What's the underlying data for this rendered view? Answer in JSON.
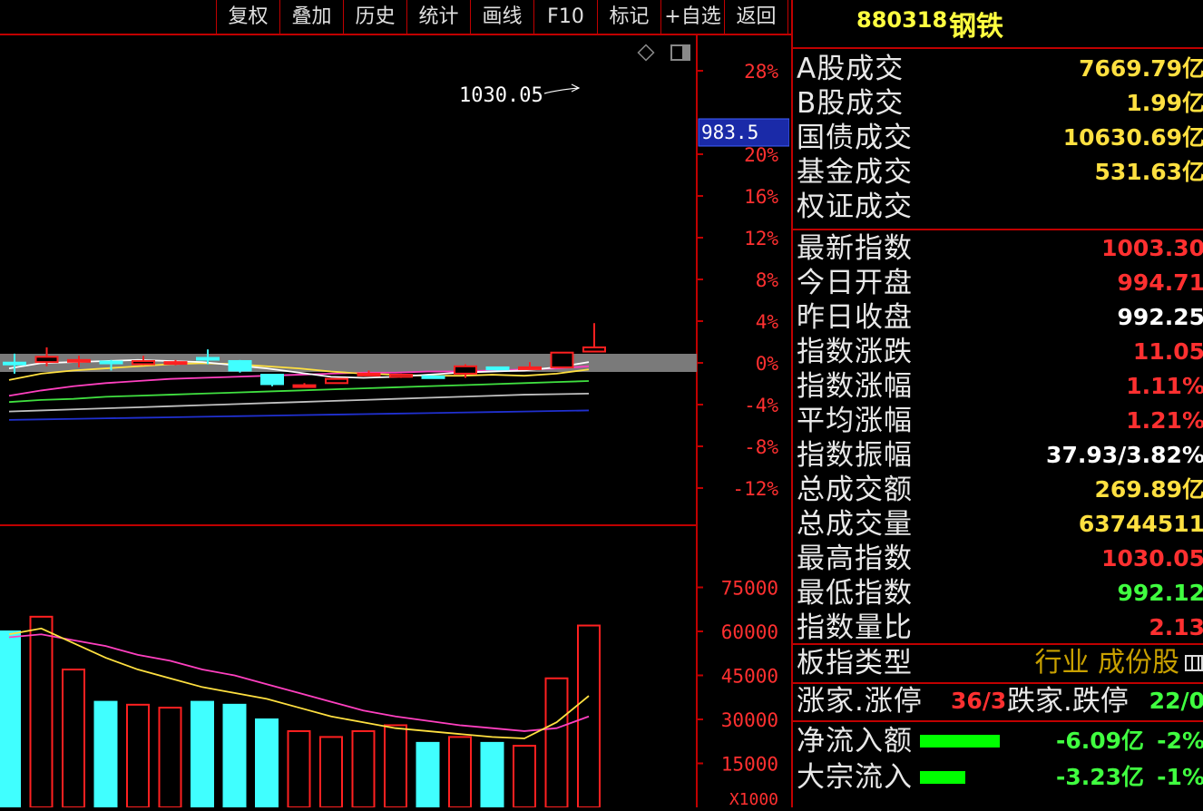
{
  "toolbar": {
    "buttons": [
      "复权",
      "叠加",
      "历史",
      "统计",
      "画线",
      "F10",
      "标记",
      "+自选",
      "返回"
    ]
  },
  "chart": {
    "annotation_high": "1030.05",
    "current_price_tag": "983.5",
    "price_axis_labels": [
      "28%",
      "20%",
      "16%",
      "12%",
      "8%",
      "4%",
      "0%",
      "-4%",
      "-8%",
      "-12%"
    ],
    "volume_axis_labels": [
      "75000",
      "60000",
      "45000",
      "30000",
      "15000",
      "X1000"
    ],
    "colors": {
      "up": "#ff2020",
      "down": "#40ffff",
      "ma5": "#ffffff",
      "ma10": "#ffe040",
      "ma20": "#ff40c0",
      "ma60": "#40e040",
      "ma120": "#c0c0c0",
      "ma250": "#2030d0",
      "axis": "#c00000",
      "tag_bg": "#1a2aa8"
    },
    "candles": [
      {
        "o": 992.5,
        "c": 992.5,
        "h": 1001,
        "l": 982,
        "up": false
      },
      {
        "o": 998,
        "c": 993,
        "h": 1007,
        "l": 989,
        "up": true
      },
      {
        "o": 995,
        "c": 995,
        "h": 999,
        "l": 988,
        "up": true
      },
      {
        "o": 992,
        "c": 993.5,
        "h": 995,
        "l": 985,
        "up": false
      },
      {
        "o": 991,
        "c": 994,
        "h": 999,
        "l": 990,
        "up": true
      },
      {
        "o": 993,
        "c": 993,
        "h": 995,
        "l": 990,
        "up": true
      },
      {
        "o": 997,
        "c": 997,
        "h": 1005,
        "l": 991,
        "up": false
      },
      {
        "o": 994,
        "c": 985,
        "h": 995,
        "l": 983,
        "up": false
      },
      {
        "o": 981,
        "c": 972,
        "h": 981,
        "l": 970,
        "up": false
      },
      {
        "o": 971,
        "c": 971,
        "h": 973,
        "l": 969,
        "up": true
      },
      {
        "o": 973,
        "c": 977,
        "h": 977,
        "l": 973,
        "up": true
      },
      {
        "o": 982,
        "c": 982,
        "h": 985,
        "l": 980,
        "up": true
      },
      {
        "o": 981,
        "c": 979,
        "h": 982,
        "l": 978,
        "up": true
      },
      {
        "o": 979,
        "c": 979.5,
        "h": 980,
        "l": 978,
        "up": false
      },
      {
        "o": 982,
        "c": 989,
        "h": 991,
        "l": 978,
        "up": true
      },
      {
        "o": 986,
        "c": 988,
        "h": 988,
        "l": 985,
        "up": false
      },
      {
        "o": 987,
        "c": 988,
        "h": 993,
        "l": 987,
        "up": true
      },
      {
        "o": 988,
        "c": 1002,
        "h": 1002,
        "l": 988,
        "up": true
      },
      {
        "o": 1003,
        "c": 1007,
        "h": 1030,
        "l": 1003,
        "up": true
      }
    ],
    "ma5": [
      987,
      992,
      993,
      994,
      995,
      994,
      993,
      990,
      987,
      983,
      979,
      978,
      979,
      981,
      983,
      984,
      985,
      988,
      993
    ],
    "ma10": [
      976,
      982,
      985,
      987,
      989,
      991,
      992,
      991,
      989,
      987,
      984,
      982,
      981,
      980,
      980,
      981,
      980,
      982,
      986
    ],
    "ma20": [
      961,
      966,
      970,
      973,
      975,
      977,
      978,
      979,
      980,
      981,
      982,
      983,
      983,
      984,
      984,
      985,
      986,
      987,
      989
    ],
    "ma60": [
      955,
      957,
      958,
      960,
      961,
      962,
      963,
      964,
      965,
      966,
      967,
      968,
      969,
      970,
      971,
      972,
      973,
      974,
      975
    ],
    "ma120": [
      946,
      947,
      948,
      949,
      950,
      951,
      952,
      953,
      954,
      955,
      956,
      957,
      958,
      959,
      960,
      961,
      962,
      962.5,
      963
    ],
    "ma250": [
      938,
      938.5,
      939,
      939.5,
      940,
      940.5,
      941,
      941.5,
      942,
      942.5,
      943,
      943.5,
      944,
      944.5,
      945,
      945.5,
      946,
      946.5,
      947
    ],
    "volumes": [
      {
        "v": 60000,
        "up": false
      },
      {
        "v": 65000,
        "up": true
      },
      {
        "v": 47000,
        "up": true
      },
      {
        "v": 36000,
        "up": false
      },
      {
        "v": 35000,
        "up": true
      },
      {
        "v": 34000,
        "up": true
      },
      {
        "v": 36000,
        "up": false
      },
      {
        "v": 35000,
        "up": false
      },
      {
        "v": 30000,
        "up": false
      },
      {
        "v": 26000,
        "up": true
      },
      {
        "v": 24000,
        "up": true
      },
      {
        "v": 26000,
        "up": true
      },
      {
        "v": 28000,
        "up": true
      },
      {
        "v": 22000,
        "up": false
      },
      {
        "v": 24000,
        "up": true
      },
      {
        "v": 22000,
        "up": false
      },
      {
        "v": 21000,
        "up": true
      },
      {
        "v": 44000,
        "up": true
      },
      {
        "v": 62000,
        "up": true
      }
    ],
    "vol_ma5": [
      59000,
      61000,
      56000,
      51000,
      47000,
      44000,
      41000,
      39000,
      37000,
      34000,
      31000,
      29000,
      27000,
      26000,
      25000,
      24000,
      23500,
      29000,
      38000
    ],
    "vol_ma10": [
      58000,
      59000,
      57000,
      55000,
      52000,
      50000,
      47000,
      45000,
      42000,
      39000,
      36000,
      33000,
      31000,
      29500,
      28000,
      27000,
      26000,
      27000,
      31000
    ]
  },
  "panel": {
    "code": "880318",
    "name": "钢铁",
    "stats": [
      {
        "label": "A股成交",
        "value": "7669.79亿",
        "color": "#ffe040"
      },
      {
        "label": "B股成交",
        "value": "1.99亿",
        "color": "#ffe040"
      },
      {
        "label": "国债成交",
        "value": "10630.69亿",
        "color": "#ffe040"
      },
      {
        "label": "基金成交",
        "value": "531.63亿",
        "color": "#ffe040"
      },
      {
        "label": "权证成交",
        "value": "",
        "color": "#ffe040"
      },
      {
        "label": "最新指数",
        "value": "1003.30",
        "color": "#ff3030"
      },
      {
        "label": "今日开盘",
        "value": "994.71",
        "color": "#ff3030"
      },
      {
        "label": "昨日收盘",
        "value": "992.25",
        "color": "#ffffff"
      },
      {
        "label": "指数涨跌",
        "value": "11.05",
        "color": "#ff3030"
      },
      {
        "label": "指数涨幅",
        "value": "1.11%",
        "color": "#ff3030"
      },
      {
        "label": "平均涨幅",
        "value": "1.21%",
        "color": "#ff3030"
      },
      {
        "label": "指数振幅",
        "value": "37.93/3.82%",
        "color": "#ffffff"
      },
      {
        "label": "总成交额",
        "value": "269.89亿",
        "color": "#ffe040"
      },
      {
        "label": "总成交量",
        "value": "63744511",
        "color": "#ffe040"
      },
      {
        "label": "最高指数",
        "value": "1030.05",
        "color": "#ff3030"
      },
      {
        "label": "最低指数",
        "value": "992.12",
        "color": "#40ff40"
      },
      {
        "label": "指数量比",
        "value": "2.13",
        "color": "#ff3030"
      }
    ],
    "sector_type_label": "板指类型",
    "sector_type_value": "行业 成份股",
    "updown": {
      "up_label": "涨家.涨停",
      "up_value": "36/3",
      "down_label": "跌家.跌停",
      "down_value": "22/0"
    },
    "flows": [
      {
        "label": "净流入额",
        "value": "-6.09亿",
        "pct": "-2%",
        "bar": 0.8
      },
      {
        "label": "大宗流入",
        "value": "-3.23亿",
        "pct": "-1%",
        "bar": 0.45
      }
    ]
  }
}
